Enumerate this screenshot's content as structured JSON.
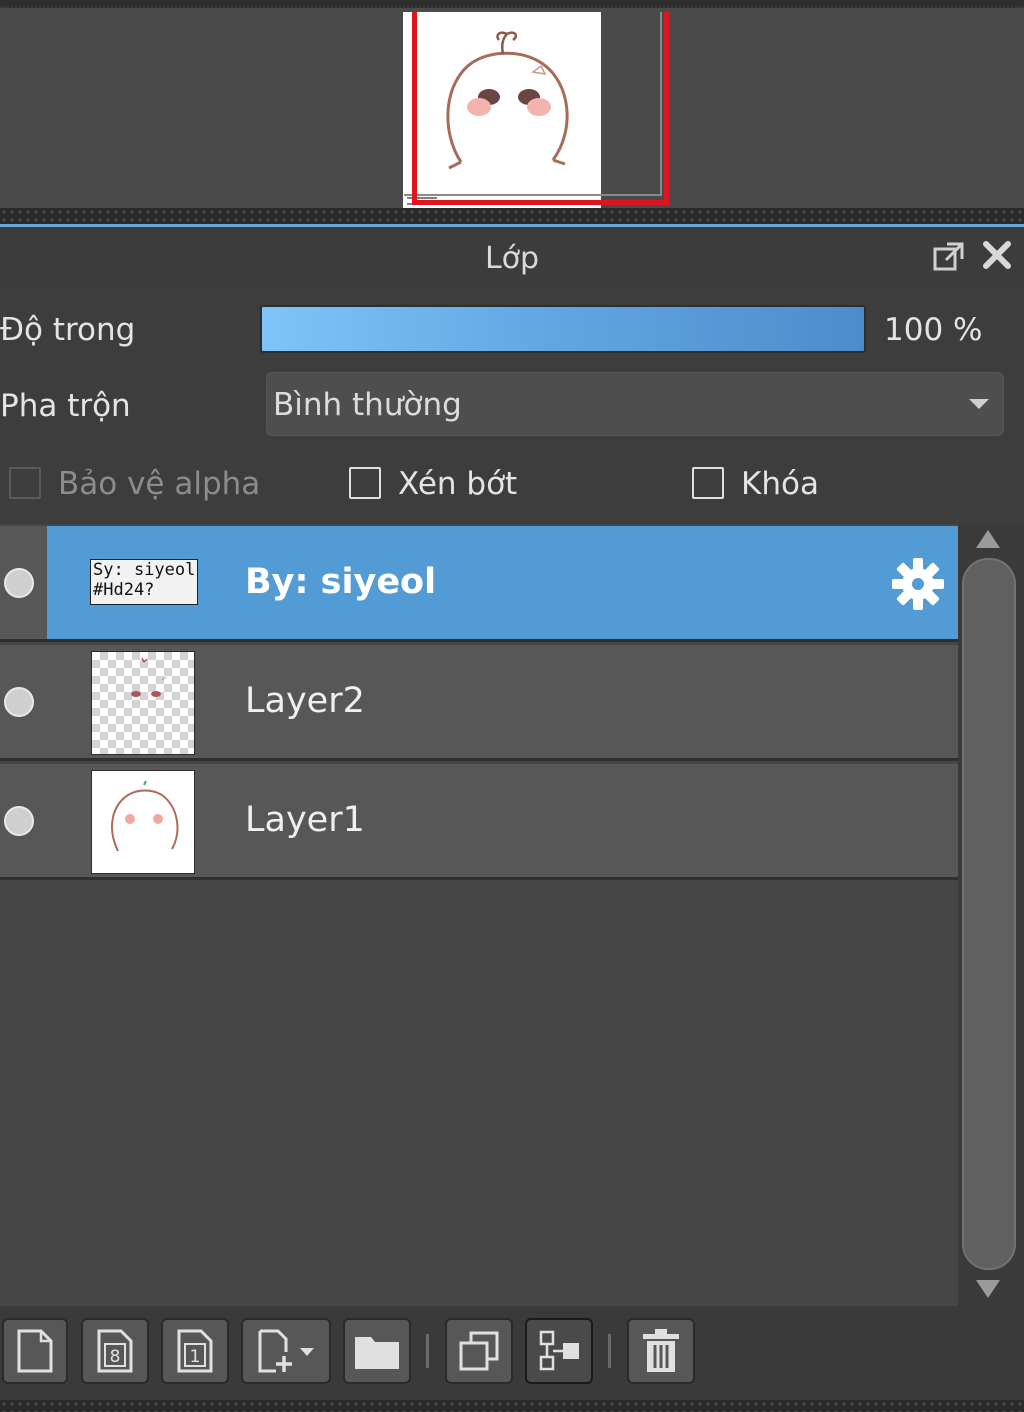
{
  "panel": {
    "title": "Lớp"
  },
  "controls": {
    "opacity_label": "Độ trong",
    "opacity_value": "100 %",
    "opacity_percent": 100,
    "blend_label": "Pha trộn",
    "blend_value": "Bình thường",
    "protect_alpha_label": "Bảo vệ alpha",
    "clipping_label": "Xén bớt",
    "lock_label": "Khóa"
  },
  "layers": [
    {
      "name": "By: siyeol",
      "thumb_text": [
        "Sy: siyeol",
        "#Hd24?"
      ],
      "selected": true
    },
    {
      "name": "Layer2",
      "selected": false
    },
    {
      "name": "Layer1",
      "selected": false
    }
  ],
  "toolbar": {
    "buttons": [
      "new-layer-icon",
      "new-8bit-layer-icon",
      "new-1bit-layer-icon",
      "add-layer-dropdown-icon",
      "folder-icon",
      "duplicate-icon",
      "merge-down-icon",
      "trash-icon"
    ]
  },
  "colors": {
    "selected_row": "#539bd4",
    "opacity_bar": "#62a8e4",
    "viewport_frame": "#e0141d"
  }
}
